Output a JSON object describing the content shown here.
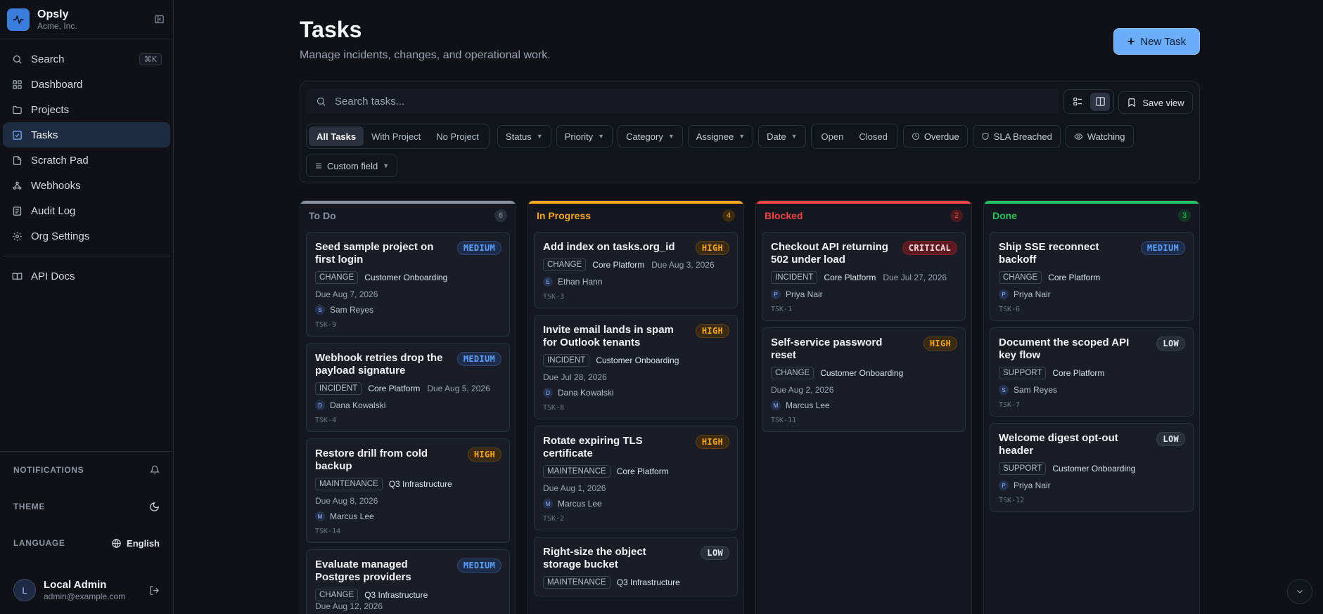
{
  "brand": {
    "name": "Opsly",
    "org": "Acme, Inc."
  },
  "nav": {
    "search": {
      "label": "Search",
      "shortcut": "⌘K"
    },
    "items": [
      {
        "label": "Dashboard",
        "icon": "grid-icon"
      },
      {
        "label": "Projects",
        "icon": "folder-icon"
      },
      {
        "label": "Tasks",
        "icon": "check-square-icon",
        "active": true
      },
      {
        "label": "Scratch Pad",
        "icon": "file-icon"
      },
      {
        "label": "Webhooks",
        "icon": "webhook-icon"
      },
      {
        "label": "Audit Log",
        "icon": "list-icon"
      },
      {
        "label": "Org Settings",
        "icon": "gear-icon"
      }
    ],
    "api_docs": "API Docs"
  },
  "sidebar_bottom": {
    "notifications": "NOTIFICATIONS",
    "theme": "THEME",
    "language": "LANGUAGE",
    "language_value": "English"
  },
  "user": {
    "initial": "L",
    "name": "Local Admin",
    "email": "admin@example.com"
  },
  "page": {
    "title": "Tasks",
    "subtitle": "Manage incidents, changes, and operational work.",
    "new_task": "New Task"
  },
  "filters": {
    "search_placeholder": "Search tasks...",
    "save_view": "Save view",
    "scope": [
      "All Tasks",
      "With Project",
      "No Project"
    ],
    "dropdowns": [
      "Status",
      "Priority",
      "Category",
      "Assignee",
      "Date"
    ],
    "state": [
      "Open",
      "Closed"
    ],
    "overdue": "Overdue",
    "sla": "SLA Breached",
    "watching": "Watching",
    "custom_field": "Custom field"
  },
  "colors": {
    "accent": "#6aaefc",
    "todo": "#8b93a3",
    "in_progress": "#f6a623",
    "blocked": "#ef4444",
    "done": "#22c55e"
  },
  "columns": [
    {
      "title": "To Do",
      "count": "6",
      "cards": [
        {
          "title": "Seed sample project on first login",
          "priority": "MEDIUM",
          "category": "CHANGE",
          "project": "Customer Onboarding",
          "due": "Due Aug 7, 2026",
          "due_wrap": true,
          "assignee": "Sam Reyes",
          "initial": "S",
          "key": "TSK-9"
        },
        {
          "title": "Webhook retries drop the payload signature",
          "priority": "MEDIUM",
          "category": "INCIDENT",
          "project": "Core Platform",
          "due": "Due Aug 5, 2026",
          "due_wrap": false,
          "assignee": "Dana Kowalski",
          "initial": "D",
          "key": "TSK-4"
        },
        {
          "title": "Restore drill from cold backup",
          "priority": "HIGH",
          "category": "MAINTENANCE",
          "project": "Q3 Infrastructure",
          "due": "Due Aug 8, 2026",
          "due_wrap": true,
          "assignee": "Marcus Lee",
          "initial": "M",
          "key": "TSK-14"
        },
        {
          "title": "Evaluate managed Postgres providers",
          "priority": "MEDIUM",
          "category": "CHANGE",
          "project": "Q3 Infrastructure",
          "due": "Due Aug 12, 2026",
          "due_wrap": false,
          "assignee": "",
          "initial": "",
          "key": ""
        }
      ]
    },
    {
      "title": "In Progress",
      "count": "4",
      "cards": [
        {
          "title": "Add index on tasks.org_id",
          "priority": "HIGH",
          "category": "CHANGE",
          "project": "Core Platform",
          "due": "Due Aug 3, 2026",
          "due_wrap": false,
          "assignee": "Ethan Hann",
          "initial": "E",
          "key": "TSK-3"
        },
        {
          "title": "Invite email lands in spam for Outlook tenants",
          "priority": "HIGH",
          "category": "INCIDENT",
          "project": "Customer Onboarding",
          "due": "Due Jul 28, 2026",
          "due_wrap": true,
          "assignee": "Dana Kowalski",
          "initial": "D",
          "key": "TSK-8"
        },
        {
          "title": "Rotate expiring TLS certificate",
          "priority": "HIGH",
          "category": "MAINTENANCE",
          "project": "Core Platform",
          "due": "Due Aug 1, 2026",
          "due_wrap": true,
          "assignee": "Marcus Lee",
          "initial": "M",
          "key": "TSK-2"
        },
        {
          "title": "Right-size the object storage bucket",
          "priority": "LOW",
          "category": "MAINTENANCE",
          "project": "Q3 Infrastructure",
          "due": "",
          "due_wrap": false,
          "assignee": "",
          "initial": "",
          "key": ""
        }
      ]
    },
    {
      "title": "Blocked",
      "count": "2",
      "cards": [
        {
          "title": "Checkout API returning 502 under load",
          "priority": "CRITICAL",
          "category": "INCIDENT",
          "project": "Core Platform",
          "due": "Due Jul 27, 2026",
          "due_wrap": false,
          "assignee": "Priya Nair",
          "initial": "P",
          "key": "TSK-1"
        },
        {
          "title": "Self-service password reset",
          "priority": "HIGH",
          "category": "CHANGE",
          "project": "Customer Onboarding",
          "due": "Due Aug 2, 2026",
          "due_wrap": true,
          "assignee": "Marcus Lee",
          "initial": "M",
          "key": "TSK-11"
        }
      ]
    },
    {
      "title": "Done",
      "count": "3",
      "cards": [
        {
          "title": "Ship SSE reconnect backoff",
          "priority": "MEDIUM",
          "category": "CHANGE",
          "project": "Core Platform",
          "due": "",
          "due_wrap": false,
          "assignee": "Priya Nair",
          "initial": "P",
          "key": "TSK-6"
        },
        {
          "title": "Document the scoped API key flow",
          "priority": "LOW",
          "category": "SUPPORT",
          "project": "Core Platform",
          "due": "",
          "due_wrap": false,
          "assignee": "Sam Reyes",
          "initial": "S",
          "key": "TSK-7"
        },
        {
          "title": "Welcome digest opt-out header",
          "priority": "LOW",
          "category": "SUPPORT",
          "project": "Customer Onboarding",
          "due": "",
          "due_wrap": false,
          "assignee": "Priya Nair",
          "initial": "P",
          "key": "TSK-12"
        }
      ]
    }
  ]
}
